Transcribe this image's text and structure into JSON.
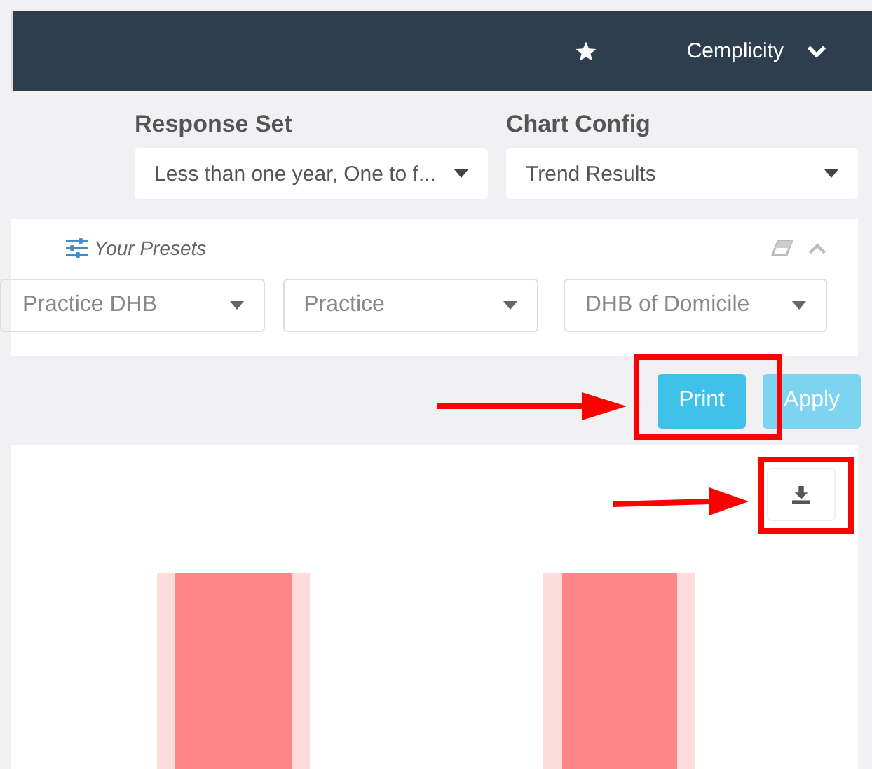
{
  "header": {
    "account": "Cemplicity"
  },
  "filters": [
    {
      "label": "Response Set",
      "value": "Less than one year, One to f..."
    },
    {
      "label": "Chart Config",
      "value": "Trend Results"
    }
  ],
  "presets": {
    "title": "Your Presets",
    "dropdowns": [
      "Practice DHB",
      "Practice",
      "DHB of Domicile"
    ]
  },
  "buttons": [
    {
      "label": "Print",
      "disabled": false
    },
    {
      "label": "Apply",
      "disabled": true
    }
  ]
}
